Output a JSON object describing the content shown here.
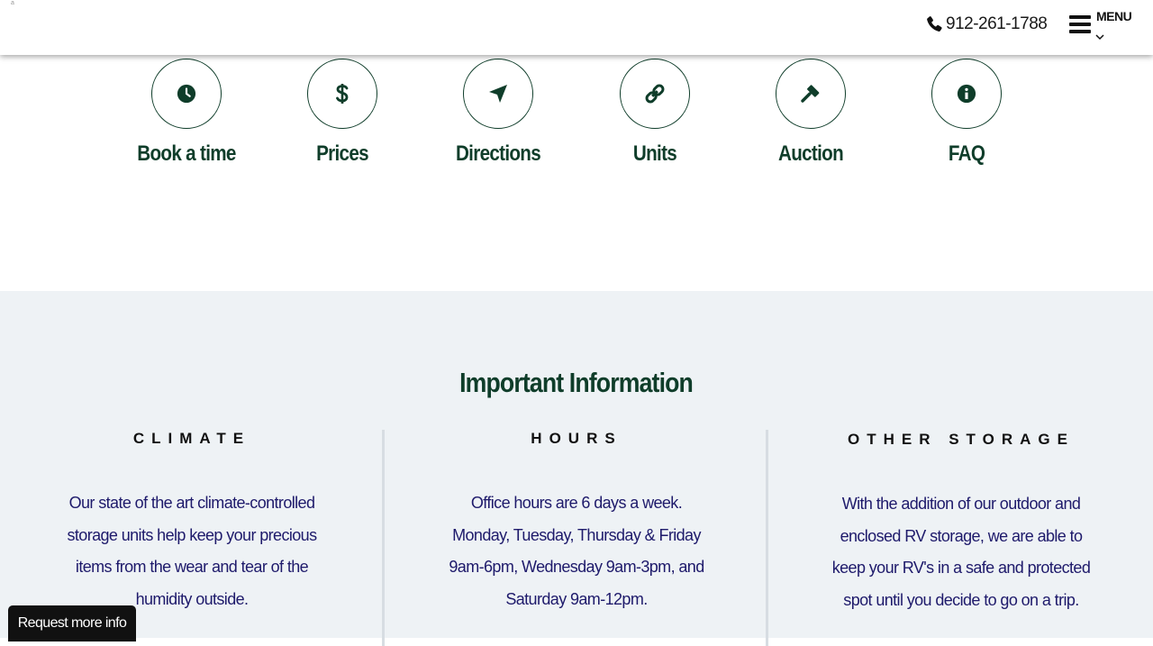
{
  "header": {
    "phone": "912-261-1788",
    "menu_label": "MENU",
    "corner_mark": "a"
  },
  "quick_links": [
    {
      "label": "Book a time",
      "icon": "clock-icon"
    },
    {
      "label": "Prices",
      "icon": "dollar-icon"
    },
    {
      "label": "Directions",
      "icon": "location-arrow-icon"
    },
    {
      "label": "Units",
      "icon": "link-icon"
    },
    {
      "label": "Auction",
      "icon": "gavel-icon"
    },
    {
      "label": "FAQ",
      "icon": "info-icon"
    }
  ],
  "info": {
    "title": "Important Information",
    "columns": [
      {
        "heading": "CLIMATE",
        "text": "Our state of the art climate-controlled storage units help keep your precious items from the wear and tear of the humidity outside."
      },
      {
        "heading": "HOURS",
        "text_line1": "Office hours are 6 days a week.",
        "text": "Monday, Tuesday, Thursday & Friday 9am-6pm, Wednesday 9am-3pm, and Saturday 9am-12pm."
      },
      {
        "heading": "OTHER STORAGE",
        "text": "With the addition of our outdoor and enclosed RV storage, we are able to keep your RV's in a safe and protected spot until you decide to go on a trip."
      }
    ]
  },
  "request_button": "Request more info",
  "colors": {
    "brand_green": "#0f3d2a",
    "body_text": "#1e1a6b",
    "section_bg": "#eef2f5"
  }
}
